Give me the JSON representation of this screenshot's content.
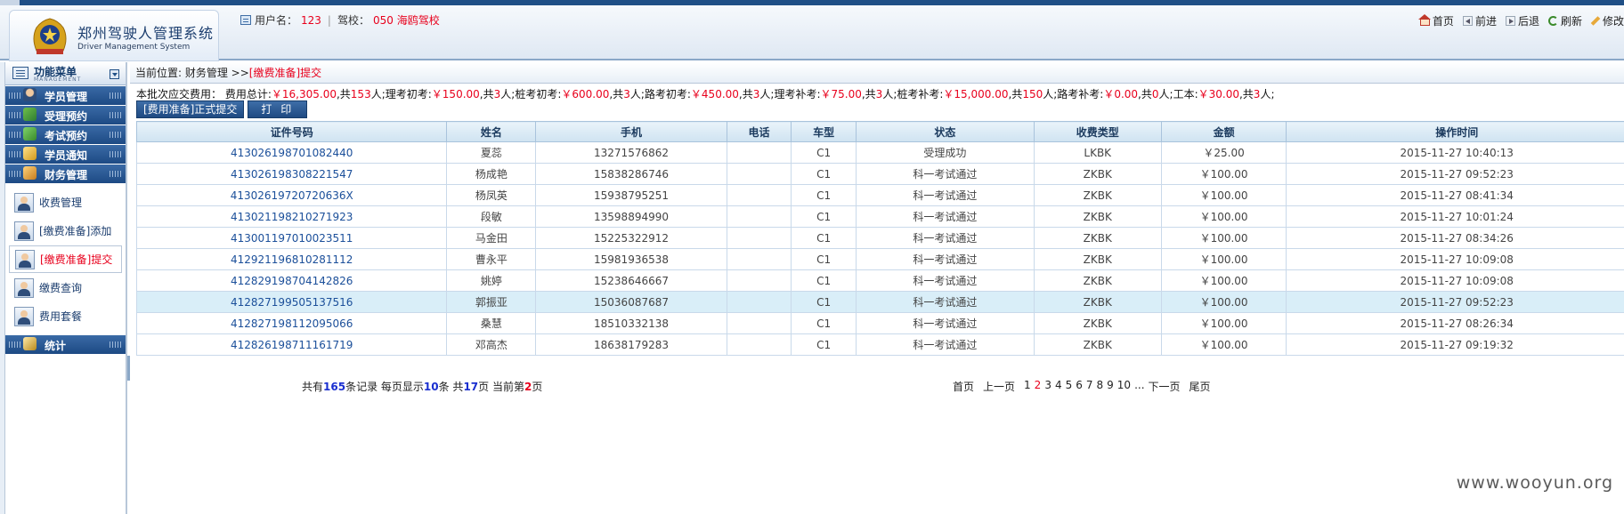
{
  "header": {
    "title": "郑州驾驶人管理系统",
    "subtitle": "Driver Management System",
    "user_label": "用户名：",
    "user_value": "123",
    "school_label": "驾校：",
    "school_value": "050 海鸥驾校",
    "nav": [
      {
        "label": "首页",
        "icon": "home-icon"
      },
      {
        "label": "前进",
        "icon": "back-icon"
      },
      {
        "label": "后退",
        "icon": "forward-icon"
      },
      {
        "label": "刷新",
        "icon": "refresh-icon"
      },
      {
        "label": "修改",
        "icon": "edit-icon"
      }
    ]
  },
  "sidebar": {
    "title": "功能菜单",
    "subtitle": "MANAGEMENT",
    "categories": [
      {
        "label": "学员管理",
        "icon": "student-icon"
      },
      {
        "label": "受理预约",
        "icon": "booking-icon"
      },
      {
        "label": "考试预约",
        "icon": "exam-icon"
      },
      {
        "label": "学员通知",
        "icon": "notice-icon"
      },
      {
        "label": "财务管理",
        "icon": "finance-icon"
      }
    ],
    "finance_items": [
      {
        "label": "收费管理"
      },
      {
        "label": "[缴费准备]添加"
      },
      {
        "label": "[缴费准备]提交",
        "active": true
      },
      {
        "label": "缴费查询"
      },
      {
        "label": "费用套餐"
      }
    ],
    "stats_label": "统计"
  },
  "breadcrumb": {
    "prefix": "当前位置: ",
    "path": "财务管理 >>",
    "current": "[缴费准备]提交"
  },
  "summary": {
    "label": "本批次应交费用：",
    "items": [
      {
        "name": "费用总计:",
        "amount": "￥16,305.00",
        "count": "153"
      },
      {
        "name": "理考初考:",
        "amount": "￥150.00",
        "count": "3"
      },
      {
        "name": "桩考初考:",
        "amount": "￥600.00",
        "count": "3"
      },
      {
        "name": "路考初考:",
        "amount": "￥450.00",
        "count": "3"
      },
      {
        "name": "理考补考:",
        "amount": "￥75.00",
        "count": "3"
      },
      {
        "name": "桩考补考:",
        "amount": "￥15,000.00",
        "count": "150"
      },
      {
        "name": "路考补考:",
        "amount": "￥0.00",
        "count": "0"
      },
      {
        "name": "工本:",
        "amount": "￥30.00",
        "count": "3"
      }
    ],
    "mid": ",共",
    "unit": "人;"
  },
  "buttons": {
    "submit": "[费用准备]正式提交",
    "print": "打 印"
  },
  "table": {
    "columns": [
      "证件号码",
      "姓名",
      "手机",
      "电话",
      "车型",
      "状态",
      "收费类型",
      "金额",
      "操作时间"
    ],
    "rows": [
      [
        "413026198701082440",
        "夏蕊",
        "13271576862",
        "",
        "C1",
        "受理成功",
        "LKBK",
        "￥25.00",
        "2015-11-27 10:40:13"
      ],
      [
        "413026198308221547",
        "杨成艳",
        "15838286746",
        "",
        "C1",
        "科一考试通过",
        "ZKBK",
        "￥100.00",
        "2015-11-27 09:52:23"
      ],
      [
        "41302619720720636X",
        "杨凤英",
        "15938795251",
        "",
        "C1",
        "科一考试通过",
        "ZKBK",
        "￥100.00",
        "2015-11-27 08:41:34"
      ],
      [
        "413021198210271923",
        "段敏",
        "13598894990",
        "",
        "C1",
        "科一考试通过",
        "ZKBK",
        "￥100.00",
        "2015-11-27 10:01:24"
      ],
      [
        "413001197010023511",
        "马金田",
        "15225322912",
        "",
        "C1",
        "科一考试通过",
        "ZKBK",
        "￥100.00",
        "2015-11-27 08:34:26"
      ],
      [
        "412921196810281112",
        "曹永平",
        "15981936538",
        "",
        "C1",
        "科一考试通过",
        "ZKBK",
        "￥100.00",
        "2015-11-27 10:09:08"
      ],
      [
        "412829198704142826",
        "姚婷",
        "15238646667",
        "",
        "C1",
        "科一考试通过",
        "ZKBK",
        "￥100.00",
        "2015-11-27 10:09:08"
      ],
      [
        "412827199505137516",
        "郭振亚",
        "15036087687",
        "",
        "C1",
        "科一考试通过",
        "ZKBK",
        "￥100.00",
        "2015-11-27 09:52:23"
      ],
      [
        "412827198112095066",
        "桑慧",
        "18510332138",
        "",
        "C1",
        "科一考试通过",
        "ZKBK",
        "￥100.00",
        "2015-11-27 08:26:34"
      ],
      [
        "412826198711161719",
        "邓高杰",
        "18638179283",
        "",
        "C1",
        "科一考试通过",
        "ZKBK",
        "￥100.00",
        "2015-11-27 09:19:32"
      ]
    ],
    "highlighted_row": 7
  },
  "pager": {
    "t1": "共有",
    "total": "165",
    "t2": "条记录 每页显示",
    "per_page": "10",
    "t3": "条 共",
    "pages": "17",
    "t4": "页 当前第",
    "current": "2",
    "t5": "页",
    "first": "首页",
    "prev": "上一页",
    "numbers": [
      "1",
      "2",
      "3",
      "4",
      "5",
      "6",
      "7",
      "8",
      "9",
      "10",
      "..."
    ],
    "next": "下一页",
    "last": "尾页"
  },
  "watermark": "www.wooyun.org",
  "colors": {
    "accent": "#1f4f86",
    "highlight": "#e8001c",
    "row_highlight": "#d9eef8"
  }
}
